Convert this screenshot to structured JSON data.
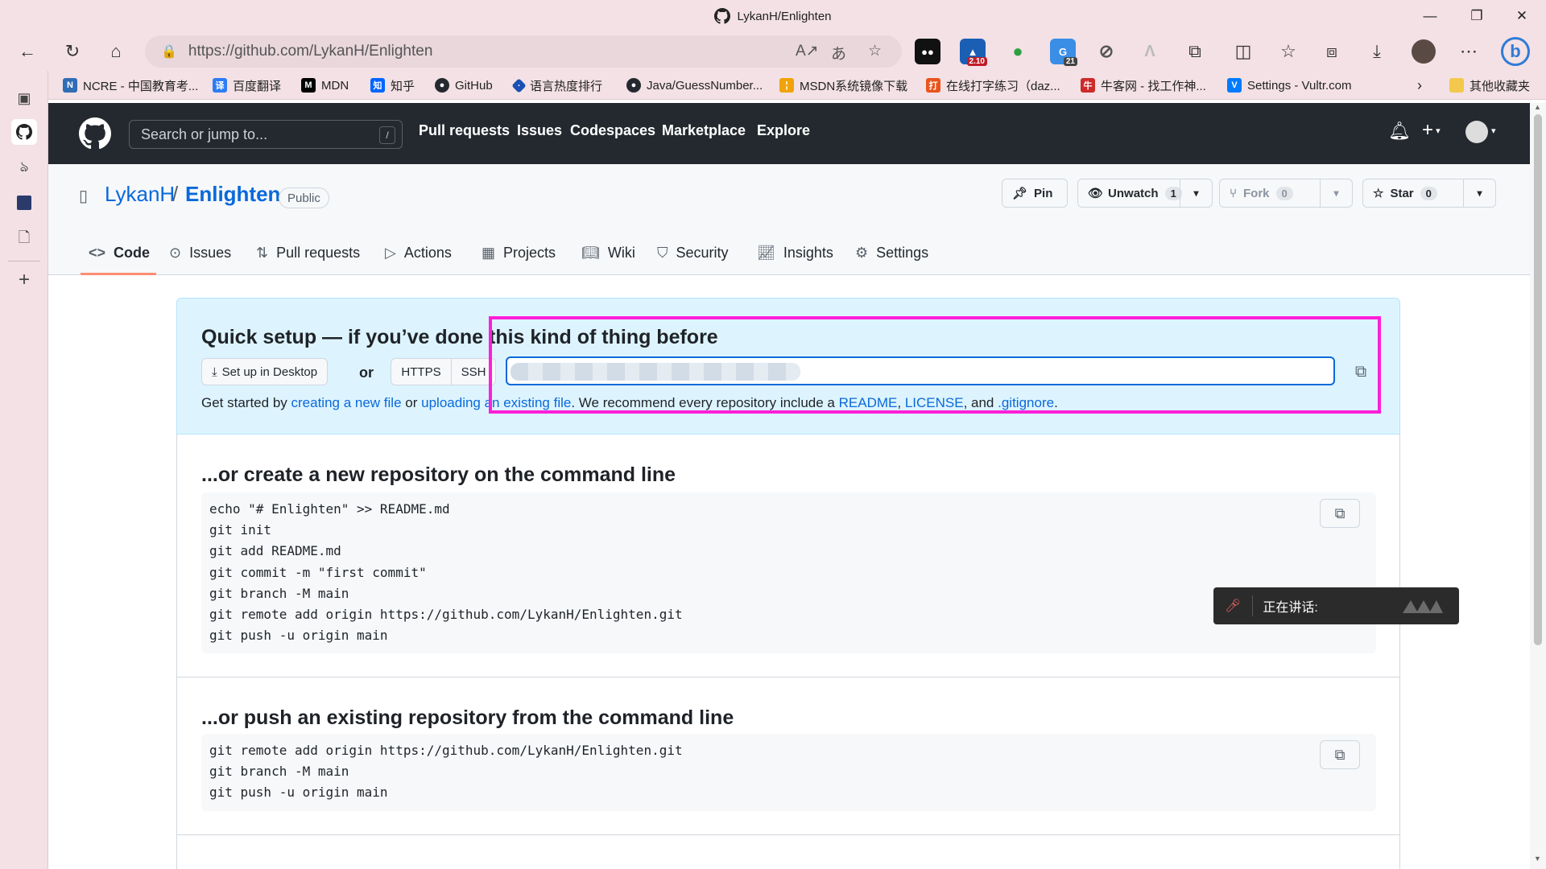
{
  "browser": {
    "title": "LykanH/Enlighten",
    "url": "https://github.com/LykanH/Enlighten",
    "ext_badges": [
      "2.10",
      "21"
    ],
    "bookmarks": [
      {
        "label": "NCRE - 中国教育考...",
        "icon_color": "#2f6db5"
      },
      {
        "label": "百度翻译",
        "icon_color": "#2d7cf6"
      },
      {
        "label": "MDN",
        "icon_color": "#000000"
      },
      {
        "label": "知乎",
        "icon_color": "#0066ff"
      },
      {
        "label": "GitHub",
        "icon_color": "#24292f"
      },
      {
        "label": "语言热度排行",
        "icon_color": "#1a4fb5"
      },
      {
        "label": "Java/GuessNumber...",
        "icon_color": "#24292f"
      },
      {
        "label": "MSDN系统镜像下载",
        "icon_color": "#f0a30a"
      },
      {
        "label": "在线打字练习（daz...",
        "icon_color": "#e8541c"
      },
      {
        "label": "牛客网 - 找工作神...",
        "icon_color": "#cc2a2a"
      },
      {
        "label": "Settings - Vultr.com",
        "icon_color": "#007bfc"
      }
    ],
    "other_bookmarks": "其他收藏夹"
  },
  "github": {
    "search_placeholder": "Search or jump to...",
    "search_key": "/",
    "nav": [
      "Pull requests",
      "Issues",
      "Codespaces",
      "Marketplace",
      "Explore"
    ]
  },
  "repo": {
    "owner": "LykanH",
    "separator": "/",
    "name": "Enlighten",
    "visibility": "Public",
    "pin_label": "Pin",
    "unwatch_label": "Unwatch",
    "unwatch_count": "1",
    "fork_label": "Fork",
    "fork_count": "0",
    "star_label": "Star",
    "star_count": "0",
    "tabs": [
      "Code",
      "Issues",
      "Pull requests",
      "Actions",
      "Projects",
      "Wiki",
      "Security",
      "Insights",
      "Settings"
    ]
  },
  "quick_setup": {
    "heading": "Quick setup — if you’ve done this kind of thing before",
    "desktop_button": "Set up in Desktop",
    "or": "or",
    "https": "HTTPS",
    "ssh": "SSH",
    "get_started": "Get started by",
    "create_link": "creating a new file",
    "or_text": "or",
    "upload_link": "uploading an existing file",
    "recommend": ". We recommend every repository include a",
    "readme": "README",
    "comma": ",",
    "license": "LICENSE",
    "and": ", and",
    "gitignore": ".gitignore",
    "period": "."
  },
  "new_repo": {
    "heading": "...or create a new repository on the command line",
    "code": "echo \"# Enlighten\" >> README.md\ngit init\ngit add README.md\ngit commit -m \"first commit\"\ngit branch -M main\ngit remote add origin https://github.com/LykanH/Enlighten.git\ngit push -u origin main"
  },
  "push_repo": {
    "heading": "...or push an existing repository from the command line",
    "code": "git remote add origin https://github.com/LykanH/Enlighten.git\ngit branch -M main\ngit push -u origin main"
  },
  "toast": {
    "text": "正在讲话:"
  },
  "colors": {
    "accent": "#0969da",
    "highlight": "#ff1fd8",
    "header": "#24292f"
  }
}
